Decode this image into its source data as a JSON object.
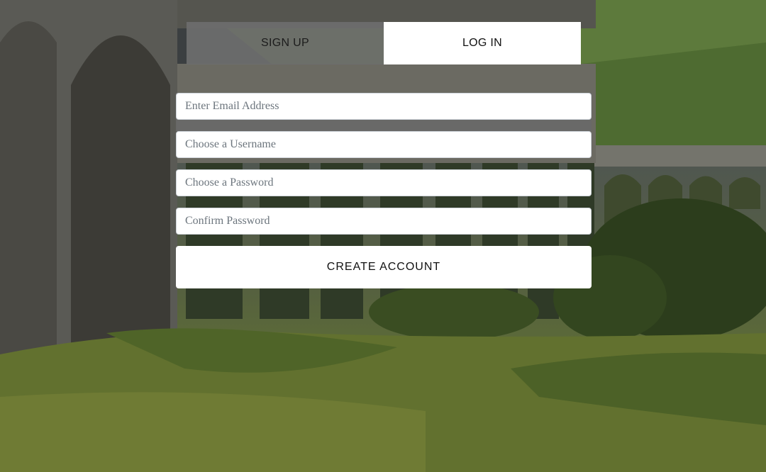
{
  "tabs": {
    "signup_label": "SIGN UP",
    "login_label": "LOG IN"
  },
  "form": {
    "email_placeholder": "Enter Email Address",
    "username_placeholder": "Choose a Username",
    "password_placeholder": "Choose a Password",
    "confirm_placeholder": "Confirm Password",
    "submit_label": "CREATE ACCOUNT"
  },
  "colors": {
    "active_tab": "#ffffff",
    "inactive_tab": "#6e6e6e",
    "button_bg": "#ffffff"
  }
}
